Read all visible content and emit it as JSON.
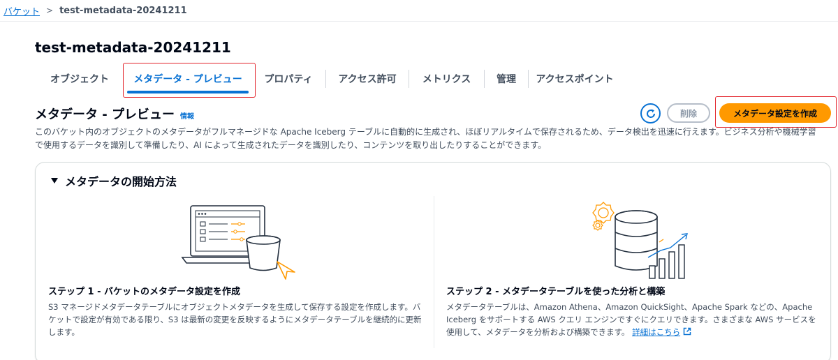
{
  "breadcrumb": {
    "parent": "バケット",
    "separator": ">",
    "current": "test-metadata-20241211"
  },
  "page": {
    "title": "test-metadata-20241211"
  },
  "tabs": [
    {
      "label": "オブジェクト",
      "active": false
    },
    {
      "label": "メタデータ - プレビュー",
      "active": true
    },
    {
      "label": "プロパティ",
      "active": false
    },
    {
      "label": "アクセス許可",
      "active": false
    },
    {
      "label": "メトリクス",
      "active": false
    },
    {
      "label": "管理",
      "active": false
    },
    {
      "label": "アクセスポイント",
      "active": false
    }
  ],
  "section": {
    "title": "メタデータ - プレビュー",
    "info": "情報",
    "description": "このバケット内のオブジェクトのメタデータがフルマネージドな Apache Iceberg テーブルに自動的に生成され、ほぼリアルタイムで保存されるため、データ検出を迅速に行えます。ビジネス分析や機械学習で使用するデータを識別して準備したり、AI によって生成されたデータを識別したり、コンテンツを取り出したりすることができます。"
  },
  "actions": {
    "delete": "削除",
    "create": "メタデータ設定を作成"
  },
  "getting_started": {
    "title": "メタデータの開始方法",
    "step1": {
      "title": "ステップ 1 - バケットのメタデータ設定を作成",
      "text": "S3 マネージドメタデータテーブルにオブジェクトメタデータを生成して保存する設定を作成します。バケットで設定が有効である限り、S3 は最新の変更を反映するようにメタデータテーブルを継続的に更新します。"
    },
    "step2": {
      "title": "ステップ 2 - メタデータテーブルを使った分析と構築",
      "text": "メタデータテーブルは、Amazon Athena、Amazon QuickSight、Apache Spark などの、Apache Iceberg をサポートする AWS クエリ エンジンですぐにクエリできます。さまざまな AWS サービスを使用して、メタデータを分析および構築できます。",
      "link": "詳細はこちら"
    }
  },
  "colors": {
    "link": "#0972d3",
    "primary_button": "#ff9900",
    "highlight": "#e3242b"
  },
  "icons": {
    "refresh": "refresh-icon",
    "external": "external-link-icon",
    "caret": "caret-down-icon"
  }
}
